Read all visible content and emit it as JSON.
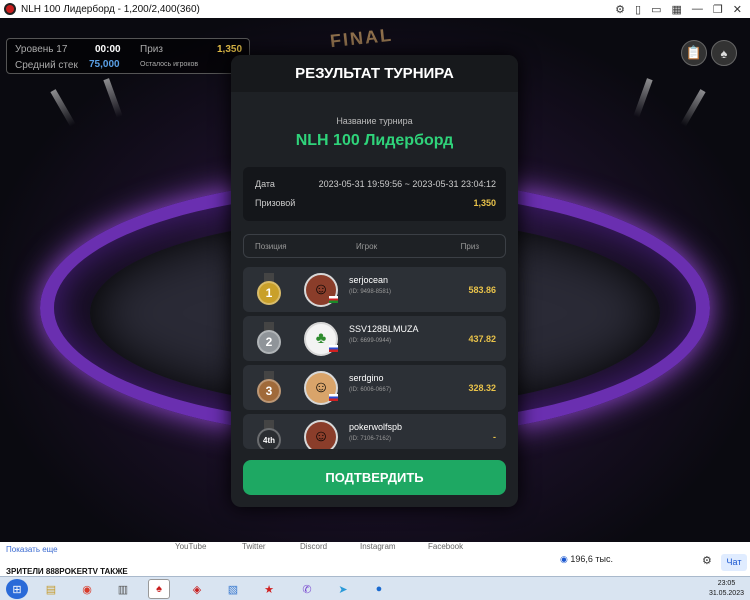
{
  "window": {
    "title": "NLH 100 Лидерборд - 1,200/2,400(360)"
  },
  "hud": {
    "level_label": "Уровень 17",
    "time": "00:00",
    "prize_label": "Приз",
    "prize_value": "1,350",
    "avg_stack_label": "Средний стек",
    "avg_stack_value": "75,000",
    "players_left_label": "Осталось игроков"
  },
  "background": {
    "sign_text": "FINAL"
  },
  "modal": {
    "title": "РЕЗУЛЬТАТ ТУРНИРА",
    "name_label": "Название турнира",
    "name_value": "NLH 100 Лидерборд",
    "date_label": "Дата",
    "date_value": "2023-05-31 19:59:56 ~ 2023-05-31 23:04:12",
    "prize_pool_label": "Призовой",
    "prize_pool_value": "1,350",
    "col_position": "Позиция",
    "col_player": "Игрок",
    "col_prize": "Приз",
    "rows": [
      {
        "place": "1",
        "name": "serjocean",
        "id": "(ID: 9498-8581)",
        "prize": "583.86"
      },
      {
        "place": "2",
        "name": "SSV128BLMUZA",
        "id": "(ID: 6699-0944)",
        "prize": "437.82"
      },
      {
        "place": "3",
        "name": "serdgino",
        "id": "(ID: 6006-0667)",
        "prize": "328.32"
      },
      {
        "place": "4th",
        "name": "pokerwolfspb",
        "id": "(ID: 7106-7162)",
        "prize": "-"
      }
    ],
    "confirm_label": "ПОДТВЕРДИТЬ"
  },
  "page": {
    "show_more": "Показать еще",
    "viewers_text": "ЗРИТЕЛИ 888POKERTV ТАКЖЕ",
    "social": [
      "YouTube",
      "Twitter",
      "Discord",
      "Instagram",
      "Facebook"
    ],
    "viewer_count": "196,6 тыс.",
    "chat_label": "Чат"
  },
  "taskbar": {
    "time": "23:05",
    "date": "31.05.2023"
  },
  "colors": {
    "accent_green": "#2fd37a",
    "confirm_green": "#1ea863",
    "prize_gold": "#e8c24a",
    "table_purple": "#6a2fb0"
  }
}
